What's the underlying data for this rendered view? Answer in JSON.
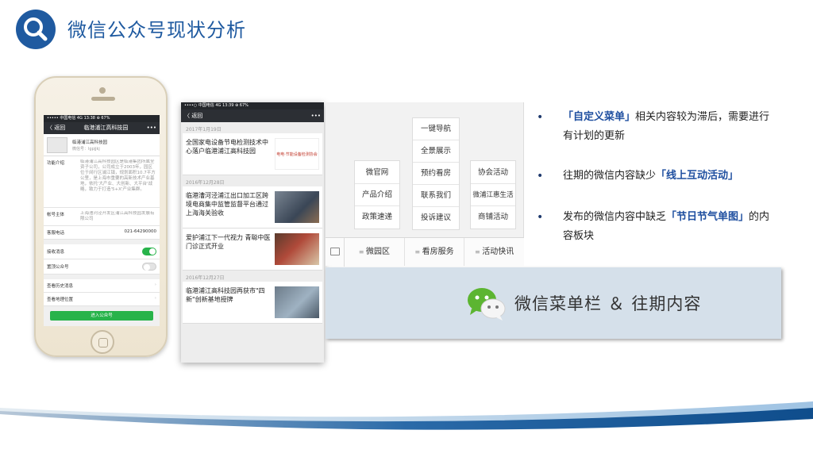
{
  "header": {
    "title": "微信公众号现状分析",
    "icon": "search-icon"
  },
  "phone1": {
    "status": "••••• 中国电信  4G   13:38   ⊕ 67%",
    "back": "〈 返回",
    "nav_title": "临港浦江高科技园",
    "more": "•••",
    "profile_name": "临港浦江高科技园",
    "profile_id": "微信号：lgpjjkj",
    "intro_label": "功能介绍",
    "intro_text": "临港浦江高科技园区是临港集团所属全资子公司，公司成立于2003年，园区位于闵行区浦江镇，规划面积10.7平方公里，是上海市重要的高新技术产业基地，依托'大产业、大创新、大平台'战略，致力于打造'5+X'产业集群。",
    "subject_label": "帐号主体",
    "subject_text": "上海漕河泾开发区浦江高科技园发展有限公司",
    "phone_label": "客服电话",
    "phone_value": "021-64290000",
    "receive_label": "接收消息",
    "top_label": "置顶公众号",
    "history_label": "查看历史消息",
    "location_label": "查看地理位置",
    "enter_button": "进入公众号"
  },
  "phone2": {
    "status": "••••○ 中国电信  4G   13:39   ⊕ 67%",
    "back": "〈 返回",
    "more": "•••",
    "date1": "2017年1月19日",
    "article1": "全国家电设备节电检测技术中心落户临港浦江高科技园",
    "thumb1_text": "电电·节能设备检测协会",
    "date2": "2016年12月28日",
    "article2": "临港漕河泾浦江出口加工区跨境电商集中监管监督平台通过上海海关验收",
    "article3": "爱护浦江下一代视力 青聪中医门诊正式开业",
    "date3": "2016年12月27日",
    "article4": "临港浦江高科技园再获市\"四新\"创新基地授牌"
  },
  "menu": {
    "col1": [
      "微官网",
      "产品介绍",
      "政策速递"
    ],
    "col2": [
      "一键导航",
      "全景展示",
      "预约看房",
      "联系我们",
      "投诉建议"
    ],
    "col3": [
      "协会活动",
      "微浦江惠生活",
      "商铺活动"
    ],
    "tabs": [
      "微园区",
      "看房服务",
      "活动快讯"
    ]
  },
  "band": {
    "text": "微信菜单栏 ＆ 往期内容",
    "icon": "wechat-icon"
  },
  "bullets": [
    {
      "pre": "",
      "hl": "「自定义菜单」",
      "post": "相关内容较为滞后，需要进行有计划的更新"
    },
    {
      "pre": "往期的微信内容缺少",
      "hl": "「线上互动活动」",
      "post": ""
    },
    {
      "pre": "发布的微信内容中缺乏",
      "hl": "「节日节气单图」",
      "post": "的内容板块"
    }
  ],
  "colors": {
    "brand_blue": "#1f5aa0",
    "wechat_green": "#27b34a",
    "band_bg": "#d5e0ea"
  }
}
